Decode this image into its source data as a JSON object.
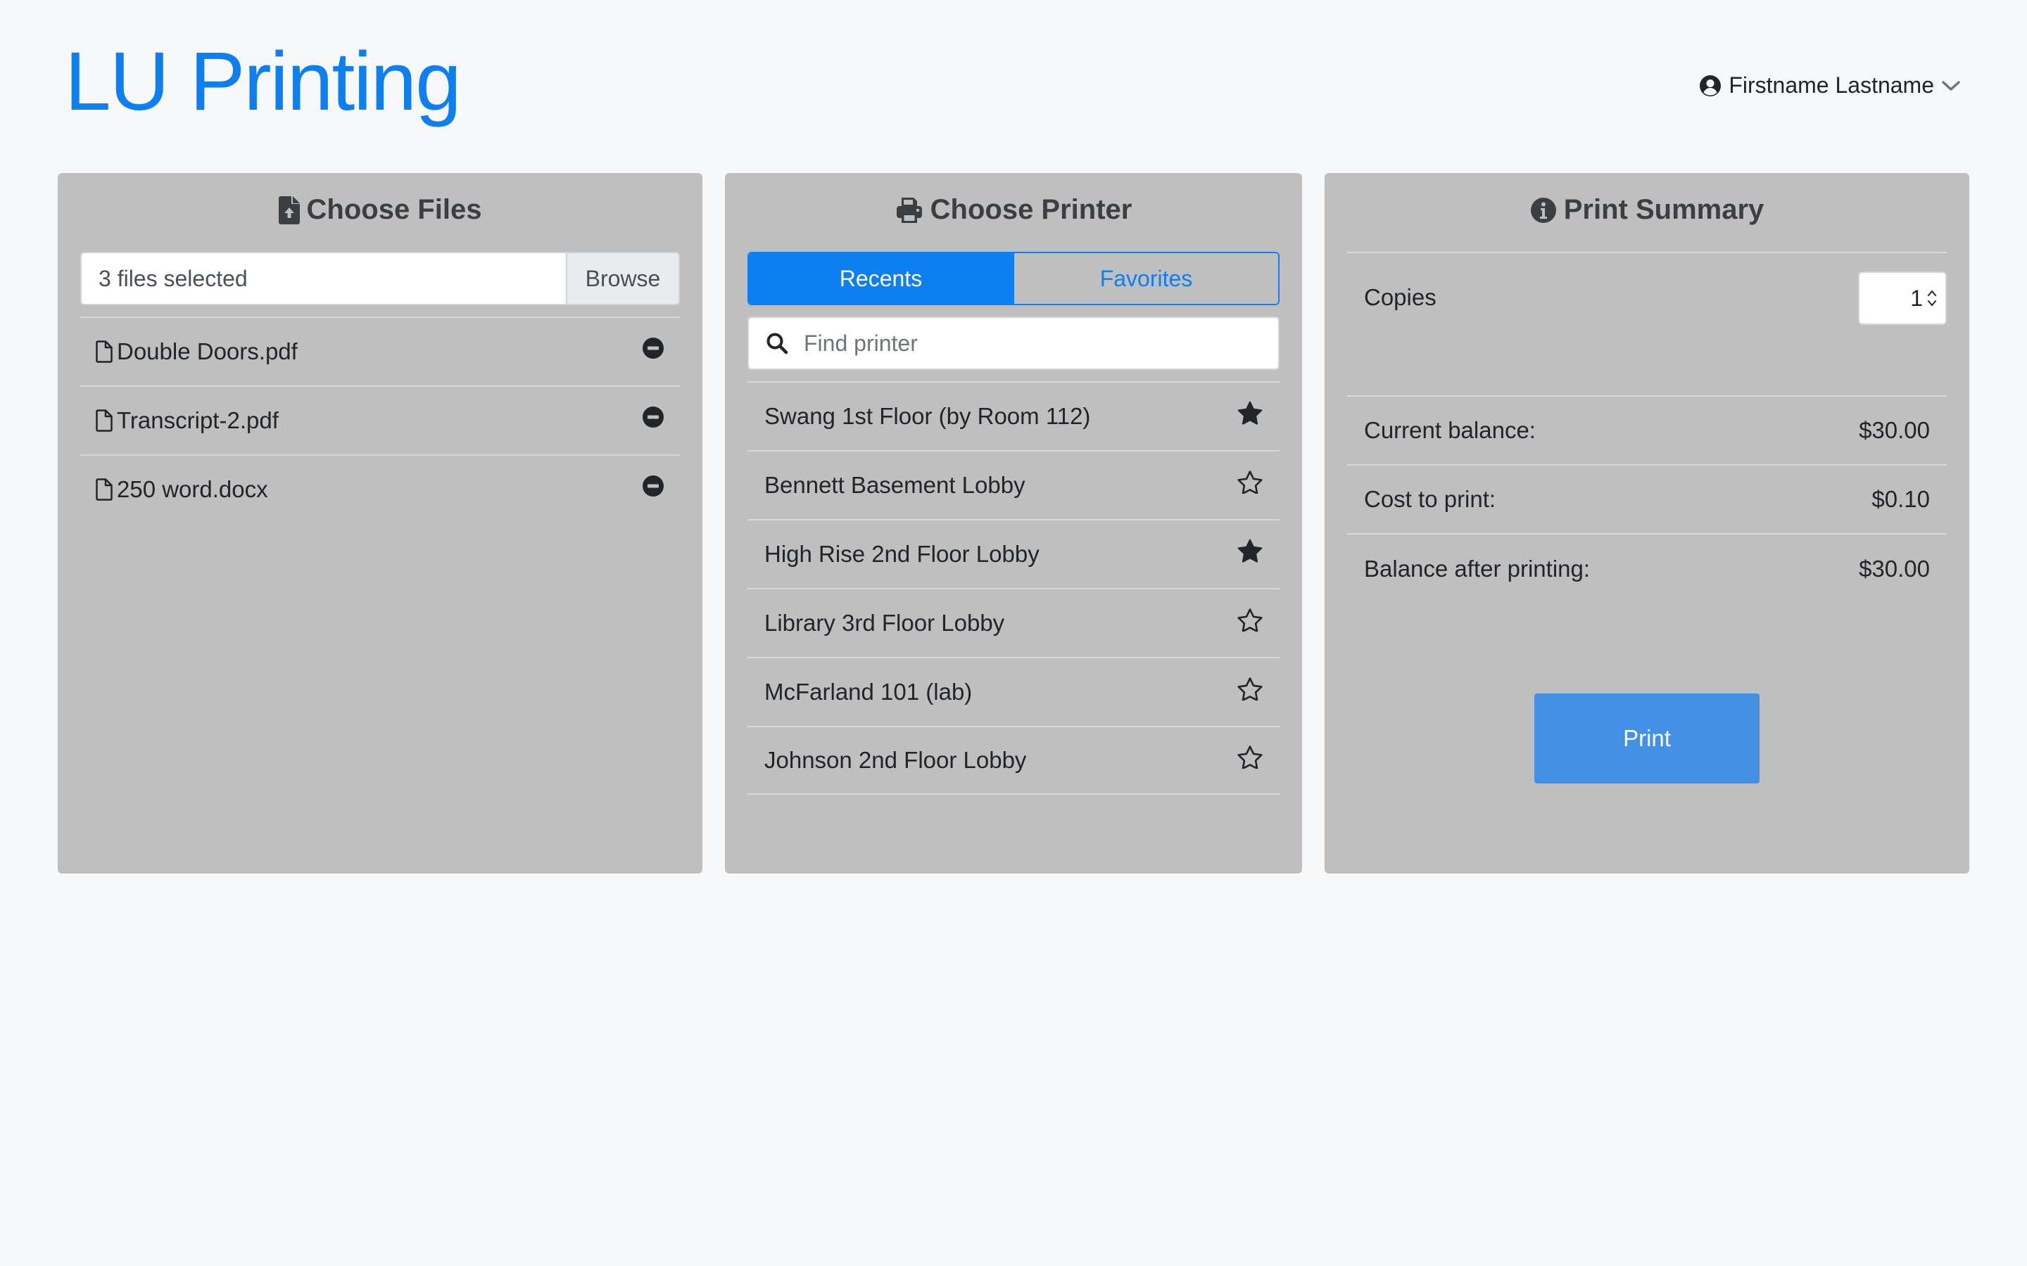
{
  "app": {
    "title": "LU Printing"
  },
  "user": {
    "name": "Firstname Lastname"
  },
  "files_panel": {
    "title": "Choose Files",
    "selected_text": "3 files selected",
    "browse_label": "Browse",
    "files": [
      {
        "name": "Double Doors.pdf"
      },
      {
        "name": "Transcript-2.pdf"
      },
      {
        "name": "250 word.docx"
      }
    ]
  },
  "printer_panel": {
    "title": "Choose Printer",
    "tabs": [
      {
        "label": "Recents",
        "active": true
      },
      {
        "label": "Favorites",
        "active": false
      }
    ],
    "search": {
      "placeholder": "Find printer",
      "value": ""
    },
    "printers": [
      {
        "name": "Swang 1st Floor (by Room 112)",
        "favorite": true
      },
      {
        "name": "Bennett Basement Lobby",
        "favorite": false
      },
      {
        "name": "High Rise 2nd Floor Lobby",
        "favorite": true
      },
      {
        "name": "Library 3rd Floor Lobby",
        "favorite": false
      },
      {
        "name": "McFarland 101 (lab)",
        "favorite": false
      },
      {
        "name": "Johnson 2nd Floor Lobby",
        "favorite": false
      }
    ]
  },
  "summary_panel": {
    "title": "Print Summary",
    "copies_label": "Copies",
    "copies_value": "1",
    "rows": [
      {
        "label": "Current balance:",
        "value": "$30.00"
      },
      {
        "label": "Cost to print:",
        "value": "$0.10"
      },
      {
        "label": "Balance after printing:",
        "value": "$30.00"
      }
    ],
    "print_label": "Print"
  },
  "colors": {
    "accent": "#0d7ff0",
    "print_button": "#4391e6",
    "panel_bg": "#bfbfbf",
    "page_bg": "#f7f8fa"
  }
}
